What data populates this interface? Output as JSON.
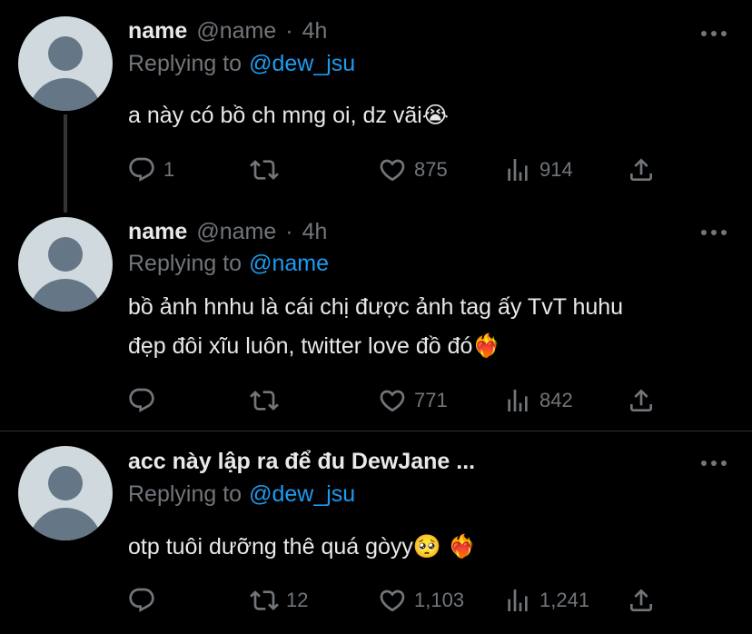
{
  "tweets": [
    {
      "name": "name",
      "handle": "@name",
      "dot": "·",
      "time": "4h",
      "replying_prefix": "Replying to",
      "replying_to": "@dew_jsu",
      "text_lines": [
        "a này có bồ ch mng oi, dz vãi😭"
      ],
      "replies": "1",
      "retweets": "",
      "likes": "875",
      "views": "914"
    },
    {
      "name": "name",
      "handle": "@name",
      "dot": "·",
      "time": "4h",
      "replying_prefix": "Replying to",
      "replying_to": "@name",
      "text_lines": [
        "bồ ảnh hnhu là cái chị được ảnh tag ấy TvT huhu",
        "đẹp đôi xĩu luôn, twitter love đồ đó❤️‍🔥"
      ],
      "replies": "",
      "retweets": "",
      "likes": "771",
      "views": "842"
    },
    {
      "name": "acc này lập ra để đu DewJane ...",
      "handle": "",
      "dot": "",
      "time": "",
      "replying_prefix": "Replying to",
      "replying_to": "@dew_jsu",
      "text_lines": [
        "otp tuôi dưỡng thê quá gòyy🥺 ❤️‍🔥"
      ],
      "replies": "",
      "retweets": "12",
      "likes": "1,103",
      "views": "1,241"
    }
  ],
  "icons": {
    "reply": "reply-icon",
    "retweet": "retweet-icon",
    "like": "heart-icon",
    "views": "views-icon",
    "share": "share-icon",
    "more": "more-icon"
  },
  "colors": {
    "background": "#000000",
    "text": "#e7e9ea",
    "muted": "#71767b",
    "accent": "#1d9bf0",
    "avatar_bg": "#cfd9de",
    "avatar_fg": "#657786"
  }
}
